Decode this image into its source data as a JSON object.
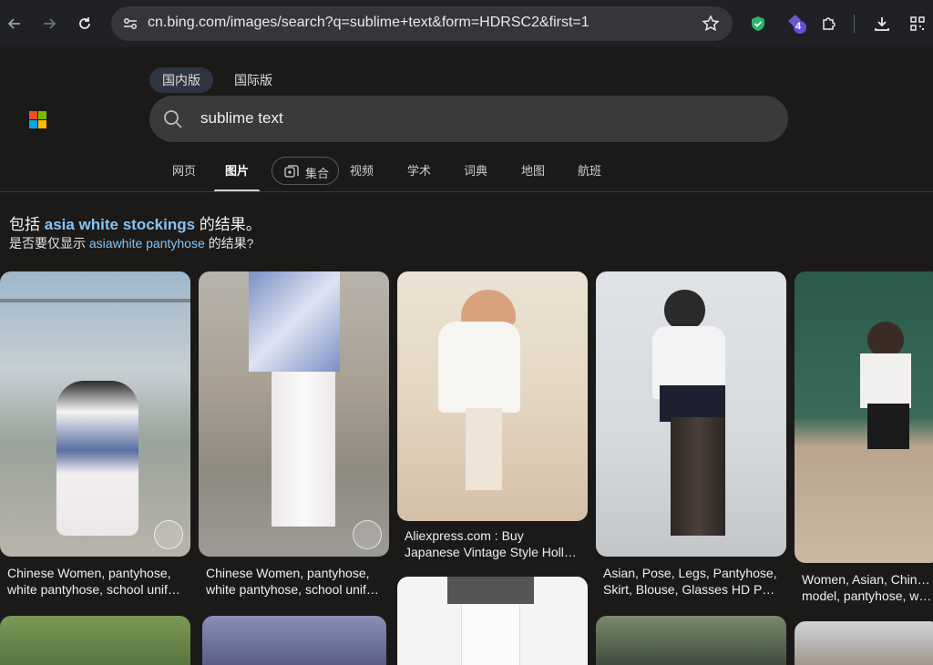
{
  "browser": {
    "url": "cn.bing.com/images/search?q=sublime+text&form=HDRSC2&first=1",
    "extension_badge": "4"
  },
  "search": {
    "region_tabs": [
      "国内版",
      "国际版"
    ],
    "query": "sublime text",
    "scopes": {
      "web": "网页",
      "images": "图片",
      "collections": "集合",
      "videos": "视频",
      "academic": "学术",
      "dict": "词典",
      "maps": "地图",
      "flights": "航班"
    }
  },
  "suggestion": {
    "line1_prefix": "包括 ",
    "line1_query": "asia white stockings",
    "line1_suffix": " 的结果。",
    "line2_prefix": "是否要仅显示 ",
    "line2_query": "asiawhite pantyhose",
    "line2_suffix": " 的结果?"
  },
  "results": [
    {
      "line1": "Chinese Women, pantyhose,",
      "line2": "white pantyhose, school unif…"
    },
    {
      "line1": "Chinese Women, pantyhose,",
      "line2": "white pantyhose, school unif…"
    },
    {
      "line1": "Aliexpress.com : Buy",
      "line2": "Japanese Vintage Style Holl…"
    },
    {
      "line1": "Asian, Pose, Legs, Pantyhose,",
      "line2": "Skirt, Blouse, Glasses HD P…"
    },
    {
      "line1": "Women, Asian, Chinese",
      "line2": "model, pantyhose, wom…"
    }
  ],
  "colors": {
    "accent_link": "#86c4f5",
    "page_bg": "#1b1a19"
  }
}
